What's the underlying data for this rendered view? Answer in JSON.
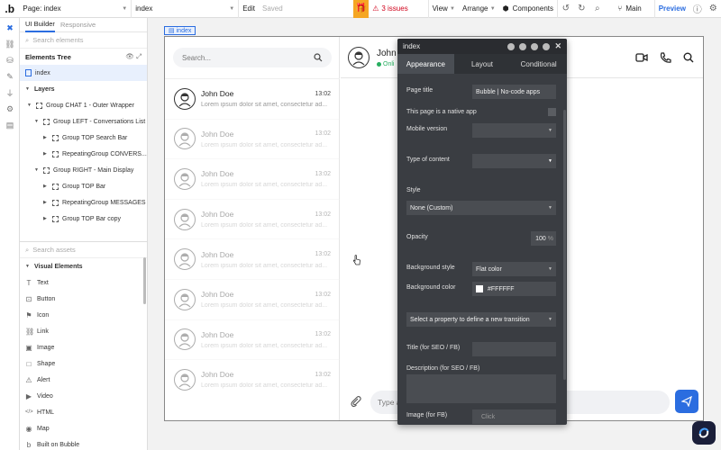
{
  "toolbar": {
    "logo": ".b",
    "page_label": "Page: index",
    "page_dropdown": "index",
    "edit": "Edit",
    "saved": "Saved",
    "issues": "3 issues",
    "view": "View",
    "arrange": "Arrange",
    "components": "Components",
    "branch": "Main",
    "preview": "Preview"
  },
  "panel": {
    "tabs": [
      "UI Builder",
      "Responsive"
    ],
    "search_elements": "Search elements",
    "elements_tree": "Elements Tree",
    "tree": [
      {
        "label": "index"
      },
      {
        "label": "Layers"
      },
      {
        "label": "Group CHAT 1 - Outer Wrapper"
      },
      {
        "label": "Group LEFT - Conversations List"
      },
      {
        "label": "Group TOP Search Bar"
      },
      {
        "label": "RepeatingGroup CONVERS..."
      },
      {
        "label": "Group RIGHT - Main Display"
      },
      {
        "label": "Group TOP Bar"
      },
      {
        "label": "RepeatingGroup MESSAGES"
      },
      {
        "label": "Group TOP Bar copy"
      }
    ],
    "search_assets": "Search assets",
    "visual_elements_title": "Visual Elements",
    "visual_elements": [
      {
        "label": "Text",
        "icon": "T"
      },
      {
        "label": "Button",
        "icon": "⊡"
      },
      {
        "label": "Icon",
        "icon": "⚑"
      },
      {
        "label": "Link",
        "icon": "🔗"
      },
      {
        "label": "Image",
        "icon": "▣"
      },
      {
        "label": "Shape",
        "icon": "□"
      },
      {
        "label": "Alert",
        "icon": "⚠"
      },
      {
        "label": "Video",
        "icon": "▶"
      },
      {
        "label": "HTML",
        "icon": "</>"
      },
      {
        "label": "Map",
        "icon": "◉"
      },
      {
        "label": "Built on Bubble",
        "icon": "b"
      }
    ]
  },
  "canvas": {
    "page_tag": "index",
    "search_placeholder": "Search...",
    "conversations": [
      {
        "name": "John Doe",
        "time": "13:02",
        "message": "Lorem ipsum dolor sit amet, consectetur ad..."
      },
      {
        "name": "John Doe",
        "time": "13:02",
        "message": "Lorem ipsum dolor sit amet, consectetur ad..."
      },
      {
        "name": "John Doe",
        "time": "13:02",
        "message": "Lorem ipsum dolor sit amet, consectetur ad..."
      },
      {
        "name": "John Doe",
        "time": "13:02",
        "message": "Lorem ipsum dolor sit amet, consectetur ad..."
      },
      {
        "name": "John Doe",
        "time": "13:02",
        "message": "Lorem ipsum dolor sit amet, consectetur ad..."
      },
      {
        "name": "John Doe",
        "time": "13:02",
        "message": "Lorem ipsum dolor sit amet, consectetur ad..."
      },
      {
        "name": "John Doe",
        "time": "13:02",
        "message": "Lorem ipsum dolor sit amet, consectetur ad..."
      },
      {
        "name": "John Doe",
        "time": "13:02",
        "message": "Lorem ipsum dolor sit amet, consectetur ad..."
      }
    ],
    "chat_name": "John",
    "chat_status": "Onli",
    "message_placeholder": "Type a"
  },
  "editor": {
    "title": "index",
    "tabs": [
      "Appearance",
      "Layout",
      "Conditional"
    ],
    "page_title_label": "Page title",
    "page_title_value": "Bubble | No-code apps",
    "native_app_label": "This page is a native app",
    "mobile_version_label": "Mobile version",
    "type_of_content_label": "Type of content",
    "style_label": "Style",
    "style_value": "None (Custom)",
    "opacity_label": "Opacity",
    "opacity_value": "100",
    "opacity_unit": "%",
    "bg_style_label": "Background style",
    "bg_style_value": "Flat color",
    "bg_color_label": "Background color",
    "bg_color_value": "#FFFFFF",
    "transition_placeholder": "Select a property to define a new transition",
    "seo_title_label": "Title (for SEO / FB)",
    "seo_desc_label": "Description (for SEO / FB)",
    "fb_image_label": "Image (for FB)",
    "fb_image_value": "Click"
  },
  "colors": {
    "accent": "#2b6de0",
    "issues": "#d0021b",
    "gift": "#f5a623",
    "online": "#27ae60",
    "editor_bg": "#3a3d42"
  }
}
